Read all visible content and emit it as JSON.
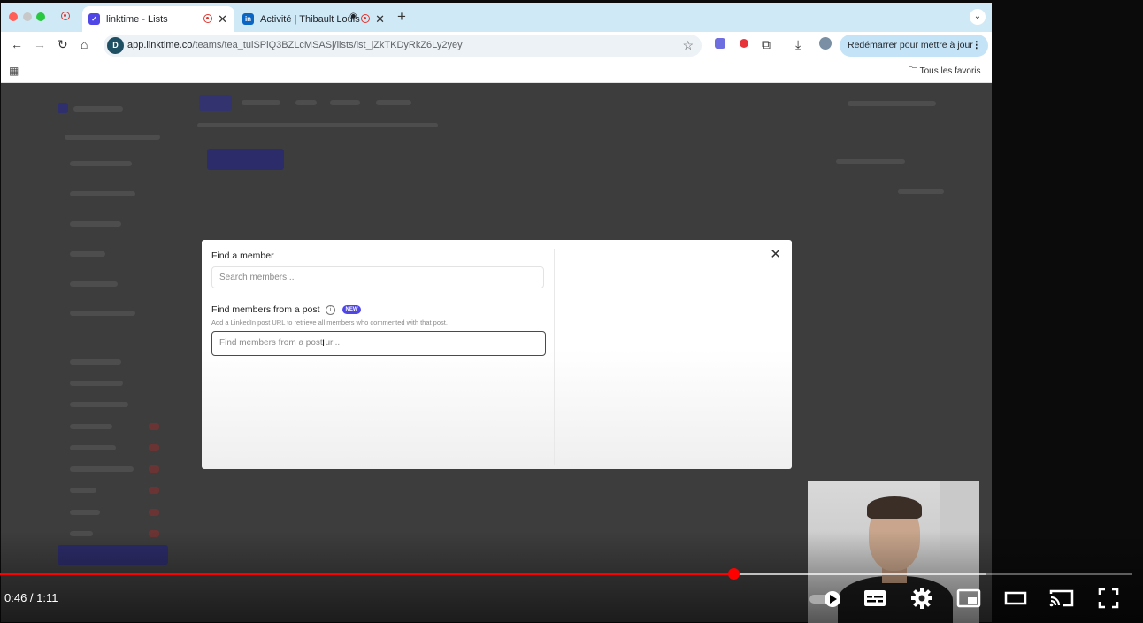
{
  "browser": {
    "tabs": [
      {
        "title": "linktime - Lists",
        "active": true
      },
      {
        "title": "Activité | Thibault Louis",
        "active": false
      }
    ],
    "new_tab_icon": "+",
    "url_domain": "app.linktime.co",
    "url_path": "/teams/tea_tuiSPiQ3BZLcMSASj/lists/lst_jZkTKDyRkZ6Ly2yey",
    "update_button": "Redémarrer pour mettre à jour",
    "bookmarks_folder": "Tous les favoris"
  },
  "modal": {
    "find_member_title": "Find a member",
    "search_placeholder": "Search members...",
    "find_post_title": "Find members from a post",
    "new_badge": "NEW",
    "post_help": "Add a LinkedIn post URL to retrieve all members who commented with that post.",
    "post_placeholder": "Find members from a post url..."
  },
  "player": {
    "current_time": "0:46",
    "duration": "1:11",
    "time_display": "0:46 / 1:11",
    "progress_fraction": 0.648,
    "buffered_fraction": 0.87,
    "accent_color": "#ff0000"
  },
  "icons": {
    "back": "arrow-left-icon",
    "forward": "arrow-right-icon",
    "reload": "reload-icon",
    "home": "home-icon",
    "star": "star-icon",
    "close": "close-icon"
  },
  "colors": {
    "tabstrip": "#cfe9f7",
    "update_button": "#c5e3f6",
    "new_badge": "#4f46e5"
  }
}
